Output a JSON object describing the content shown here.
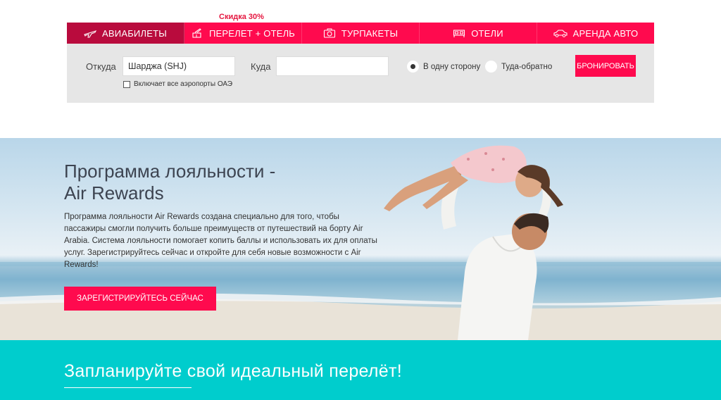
{
  "booking": {
    "discount_badge": "Скидка 30%",
    "tabs": [
      {
        "label": "АВИАБИЛЕТЫ",
        "icon": "plane-icon",
        "active": true
      },
      {
        "label": "ПЕРЕЛЕТ + ОТЕЛЬ",
        "icon": "plane-hotel-icon",
        "active": false
      },
      {
        "label": "ТУРПАКЕТЫ",
        "icon": "camera-icon",
        "active": false
      },
      {
        "label": "ОТЕЛИ",
        "icon": "bed-icon",
        "active": false
      },
      {
        "label": "АРЕНДА АВТО",
        "icon": "car-icon",
        "active": false
      }
    ],
    "from_label": "Откуда",
    "from_value": "Шарджа (SHJ)",
    "to_label": "Куда",
    "to_value": "",
    "include_airports_label": "Включает все аэропорты ОАЭ",
    "include_airports_checked": false,
    "one_way_label": "В одну сторону",
    "round_trip_label": "Туда-обратно",
    "selected_trip": "one-way",
    "book_button": "БРОНИРОВАТЬ"
  },
  "hero": {
    "title_line1": "Программа лояльности -",
    "title_line2": "Air Rewards",
    "description": "Программа лояльности Air Rewards создана специально для того, чтобы пассажиры смогли получить больше преимуществ от путешествий на борту Air Arabia. Система лояльности помогает копить баллы и использовать их для оплаты услуг. Зарегистрируйтесь сейчас и откройте для себя новые возможности с Air Rewards!",
    "register_button": "ЗАРЕГИСТРИРУЙТЕСЬ СЕЙЧАС"
  },
  "plan": {
    "title": "Запланируйте свой идеальный перелёт!"
  },
  "colors": {
    "brand_red": "#ff0a4e",
    "active_tab": "#b90b3d",
    "teal": "#00cdcd"
  }
}
